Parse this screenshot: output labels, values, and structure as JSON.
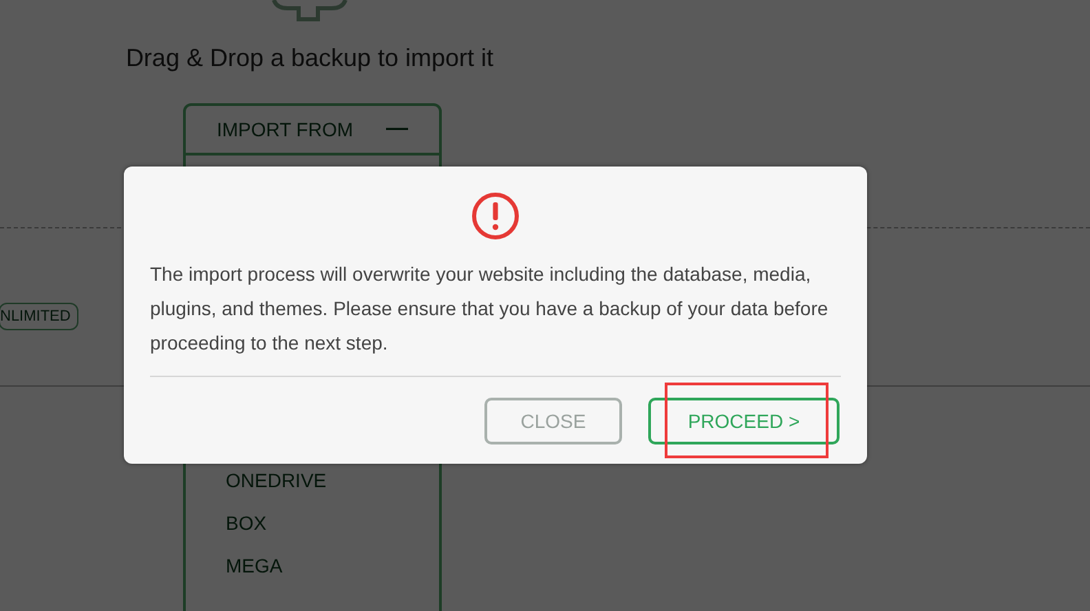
{
  "background": {
    "drop_hint": "Drag & Drop a backup to import it",
    "import_panel": {
      "title": "IMPORT FROM",
      "toggle": "—",
      "expanded": true,
      "items": [
        "ONEDRIVE",
        "BOX",
        "MEGA"
      ]
    },
    "badge": "NLIMITED"
  },
  "dialog": {
    "message": "The import process will overwrite your website including the database, media, plugins, and themes. Please ensure that you have a backup of your data before proceeding to the next step.",
    "buttons": [
      {
        "label": "CLOSE",
        "kind": "secondary",
        "highlighted": false
      },
      {
        "label": "PROCEED >",
        "kind": "primary",
        "highlighted": true
      }
    ]
  }
}
